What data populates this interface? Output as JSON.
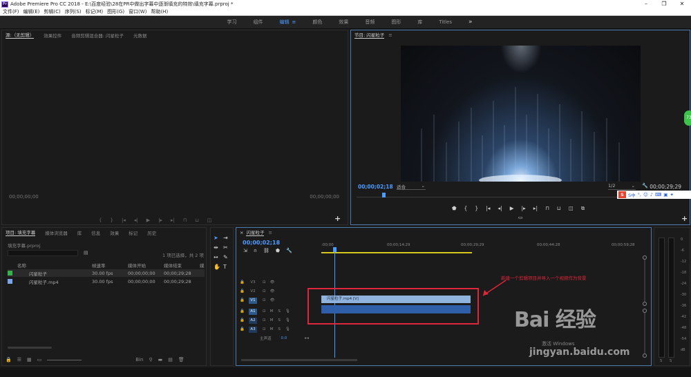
{
  "window": {
    "title": "Adobe Premiere Pro CC 2018 - E:\\百度经验\\28在PR中做出字幕中逐渐填充的特效\\填充字幕.prproj *",
    "controls": [
      "–",
      "❐",
      "✕"
    ]
  },
  "menu": [
    "文件(F)",
    "编辑(E)",
    "剪辑(C)",
    "序列(S)",
    "标记(M)",
    "图形(G)",
    "窗口(W)",
    "帮助(H)"
  ],
  "workspaces": {
    "items": [
      "学习",
      "组件",
      "编辑",
      "颜色",
      "效果",
      "音频",
      "图形",
      "库",
      "Titles"
    ],
    "active": "编辑",
    "more": "»"
  },
  "source_panel": {
    "tabs": [
      "源:（无剪辑）",
      "效果控件",
      "音频剪辑混合器: 闪星粒子",
      "元数据"
    ],
    "tc_left": "00;00;00;00",
    "tc_right": "00;00;00;00",
    "add": "+"
  },
  "program_panel": {
    "tab": "节目: 闪星粒子",
    "timecode": "00;00;02;18",
    "fit": "适合",
    "resolution": "1/2",
    "duration": "00;00;29;29",
    "add": "+"
  },
  "ime_bar": {
    "label": "S中"
  },
  "badge": {
    "label": "73"
  },
  "project_panel": {
    "tabs": [
      "项目: 填充字幕",
      "媒体浏览器",
      "库",
      "信息",
      "效果",
      "标记",
      "历史"
    ],
    "path": "填充字幕.prproj",
    "selection_info": "1 项已选择，共 2 项",
    "columns": [
      "名称",
      "帧速率",
      "媒体开始",
      "媒体结束",
      "媒"
    ],
    "rows": [
      {
        "name": "闪星粒子",
        "fps": "30.00 fps",
        "start": "00;00;00;00",
        "end": "00;00;29;28",
        "color": "#35b34a"
      },
      {
        "name": "闪星粒子.mp4",
        "fps": "30.00 fps",
        "start": "00;00;00;00",
        "end": "00;00;29;28",
        "color": "#7aa6e8"
      }
    ],
    "bin_label": "Bin"
  },
  "timeline": {
    "tab": "闪星粒子",
    "timecode": "00;00;02;18",
    "ruler": [
      ":00;00",
      "00;00;14;29",
      "00;00;29;29",
      "00;00;44;28",
      "00;00;59;28"
    ],
    "tracks": [
      {
        "id": "V3",
        "kind": "video",
        "selected": false
      },
      {
        "id": "V2",
        "kind": "video",
        "selected": false
      },
      {
        "id": "V1",
        "kind": "video",
        "selected": true
      },
      {
        "id": "A1",
        "kind": "audio",
        "selected": true
      },
      {
        "id": "A2",
        "kind": "audio",
        "selected": false
      },
      {
        "id": "A3",
        "kind": "audio",
        "selected": false
      }
    ],
    "master_label": "主声道",
    "master_value": "0.0",
    "clip_label": "闪星粒子.mp4 [V]",
    "annotation": "新建一个剪辑项目并导入一个视频作为背景"
  },
  "meter": {
    "scale": [
      "0",
      "-6",
      "-12",
      "-18",
      "-24",
      "-30",
      "-36",
      "-42",
      "-48",
      "-54",
      "dB"
    ],
    "solo": [
      "S",
      "S"
    ]
  },
  "watermark": {
    "brand": "Bai 经验",
    "sub": "jingyan.baidu.com",
    "windows": "激活 Windows"
  },
  "colors": {
    "accent": "#4c9bff",
    "annotation": "#e0263a",
    "clip_video": "#8fb3dc",
    "clip_audio": "#2f5fa8"
  }
}
